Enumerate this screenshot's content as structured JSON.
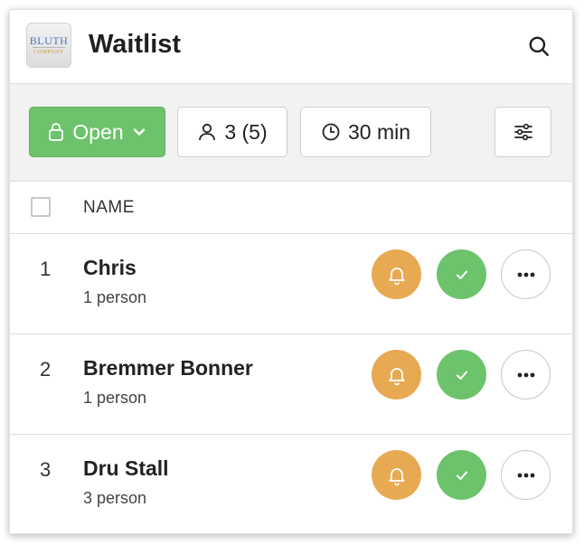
{
  "header": {
    "logo_line1": "BLUTH",
    "logo_line2": "COMPANY",
    "title": "Waitlist",
    "search_icon": "search-icon"
  },
  "toolbar": {
    "status_label": "Open",
    "guests_label": "3 (5)",
    "wait_label": "30 min",
    "colors": {
      "open": "#6cc36b",
      "notify": "#e8a953",
      "seat": "#6cc36b"
    }
  },
  "table": {
    "column_name": "NAME",
    "rows": [
      {
        "index": "1",
        "name": "Chris",
        "party": "1 person"
      },
      {
        "index": "2",
        "name": "Bremmer Bonner",
        "party": "1 person"
      },
      {
        "index": "3",
        "name": "Dru Stall",
        "party": "3 person"
      }
    ]
  }
}
